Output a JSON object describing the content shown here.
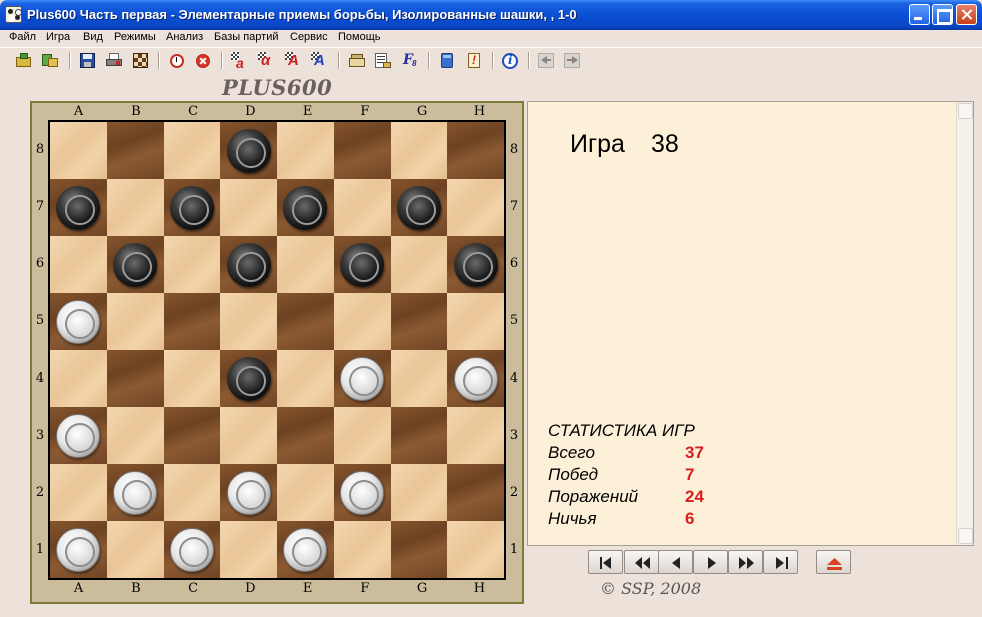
{
  "window": {
    "title": "Plus600 Часть первая - Элементарные приемы борьбы, Изолированные шашки, , 1-0",
    "icon": "checkers-app-icon"
  },
  "menu": [
    "Файл",
    "Игра",
    "Вид",
    "Режимы",
    "Анализ",
    "Базы партий",
    "Сервис",
    "Помощь"
  ],
  "toolbar": {
    "buttons": [
      "open-icon",
      "import-icon",
      "save-icon",
      "print-icon",
      "edit-board-icon",
      "clock-icon",
      "stop-icon",
      "analysis-a-icon",
      "alpha-icon",
      "analysis-a2-icon",
      "analysis-a3-icon",
      "book-icon",
      "notation-icon",
      "formula-icon",
      "database-icon",
      "exclamation-icon",
      "info-icon",
      "back-arrow-icon",
      "forward-arrow-icon"
    ]
  },
  "brand": "PLUS600",
  "board": {
    "files": [
      "A",
      "B",
      "C",
      "D",
      "E",
      "F",
      "G",
      "H"
    ],
    "ranks": [
      "8",
      "7",
      "6",
      "5",
      "4",
      "3",
      "2",
      "1"
    ],
    "pieces": [
      {
        "square": "d8",
        "color": "black"
      },
      {
        "square": "a7",
        "color": "black"
      },
      {
        "square": "c7",
        "color": "black"
      },
      {
        "square": "e7",
        "color": "black"
      },
      {
        "square": "g7",
        "color": "black"
      },
      {
        "square": "b6",
        "color": "black"
      },
      {
        "square": "d6",
        "color": "black"
      },
      {
        "square": "f6",
        "color": "black"
      },
      {
        "square": "h6",
        "color": "black"
      },
      {
        "square": "a5",
        "color": "white"
      },
      {
        "square": "d4",
        "color": "black"
      },
      {
        "square": "f4",
        "color": "white"
      },
      {
        "square": "h4",
        "color": "white"
      },
      {
        "square": "a3",
        "color": "white"
      },
      {
        "square": "b2",
        "color": "white"
      },
      {
        "square": "d2",
        "color": "white"
      },
      {
        "square": "f2",
        "color": "white"
      },
      {
        "square": "a1",
        "color": "white"
      },
      {
        "square": "c1",
        "color": "white"
      },
      {
        "square": "e1",
        "color": "white"
      }
    ]
  },
  "panel": {
    "game_label": "Игра",
    "game_number": "38",
    "stats_title": "СТАТИСТИКА ИГР",
    "stats": [
      {
        "label": "Всего",
        "value": "37"
      },
      {
        "label": "Побед",
        "value": "7"
      },
      {
        "label": "Поражений",
        "value": "24"
      },
      {
        "label": "Ничья",
        "value": "6"
      }
    ]
  },
  "navigation": [
    "first-move-icon",
    "rewind-icon",
    "step-back-icon",
    "step-forward-icon",
    "fast-forward-icon",
    "last-move-icon",
    "eject-icon"
  ],
  "copyright": "©  SSP, 2008",
  "colors": {
    "titlebar": "#0a4fd4",
    "window_bg": "#ece2da",
    "panel_bg": "#fcf0d8",
    "stat_value": "#d82020",
    "light_square": "#f0d0a4",
    "dark_square": "#7a4c28"
  }
}
